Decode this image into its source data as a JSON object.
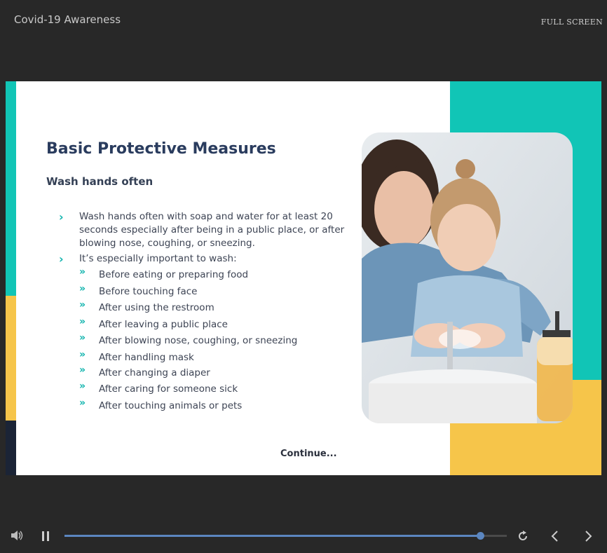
{
  "header": {
    "title": "Covid-19 Awareness",
    "fullscreen_label": "FULL SCREEN"
  },
  "slide": {
    "title": "Basic Protective Measures",
    "subtitle": "Wash hands often",
    "bullets": [
      {
        "lines": [
          "Wash hands often with soap and water for at least 20",
          "seconds especially after being in a public place, or after",
          "blowing nose, coughing, or sneezing."
        ]
      },
      {
        "lines": [
          "It’s especially important to wash:"
        ]
      }
    ],
    "sub_bullets": [
      "Before eating or preparing food",
      "Before touching face",
      "After using the restroom",
      "After leaving a public place",
      "After blowing nose, coughing, or sneezing",
      "After handling mask",
      "After changing a diaper",
      "After caring for someone sick",
      "After touching animals or pets"
    ],
    "continue_label": "Continue..."
  },
  "player": {
    "progress_fraction": 0.94,
    "buffered_fraction": 0.75
  },
  "colors": {
    "teal": "#11c5b6",
    "yellow": "#f6c54a",
    "navy": "#1b2436",
    "heading": "#2a3c5e",
    "progress": "#5b86c0"
  },
  "icons": [
    "volume-icon",
    "pause-icon",
    "replay-icon",
    "previous-icon",
    "next-icon",
    "chevron-right-icon",
    "double-chevron-right-icon"
  ]
}
